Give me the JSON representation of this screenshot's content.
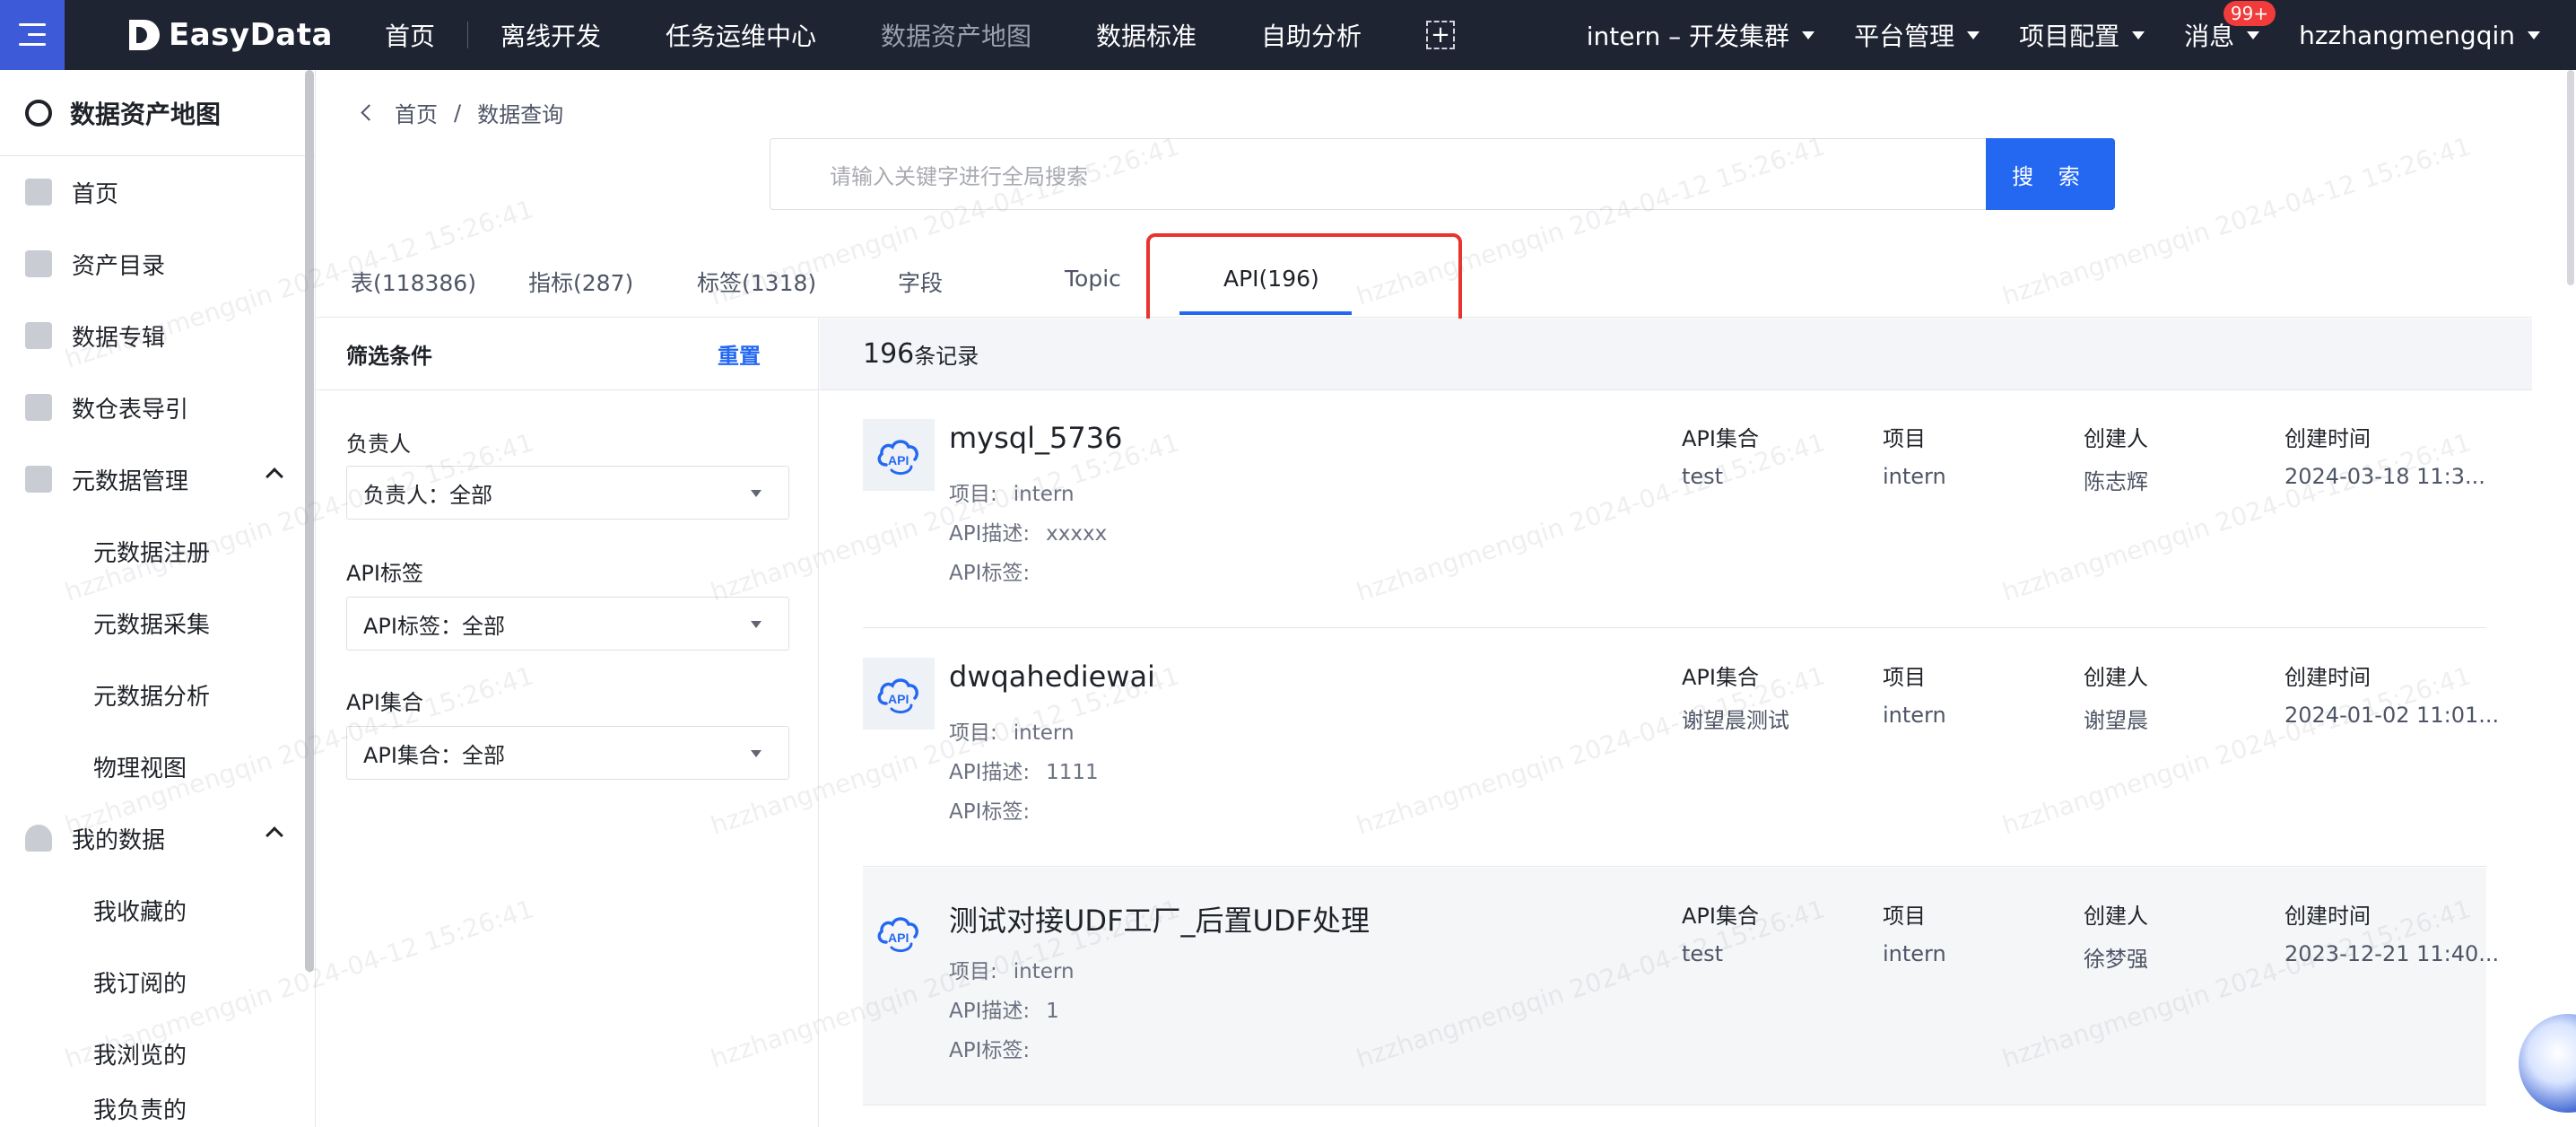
{
  "topnav": {
    "logo_text": "EasyData",
    "items": [
      "首页",
      "离线开发",
      "任务运维中心",
      "数据资产地图",
      "数据标准",
      "自助分析"
    ],
    "cluster": "intern – 开发集群",
    "platform": "平台管理",
    "project": "项目配置",
    "messages": "消息",
    "badge": "99+",
    "user": "hzzhangmengqin"
  },
  "sidebar": {
    "title": "数据资产地图",
    "items": [
      "首页",
      "资产目录",
      "数据专辑",
      "数仓表导引",
      "元数据管理",
      "元数据注册",
      "元数据采集",
      "元数据分析",
      "物理视图",
      "我的数据",
      "我收藏的",
      "我订阅的",
      "我浏览的",
      "我负责的"
    ]
  },
  "breadcrumb": {
    "home": "首页",
    "sep": "/",
    "current": "数据查询"
  },
  "search": {
    "placeholder": "请输入关键字进行全局搜索",
    "button": "搜 索"
  },
  "tabs": [
    "表(118386)",
    "指标(287)",
    "标签(1318)",
    "字段",
    "Topic",
    "API(196)"
  ],
  "filter": {
    "title": "筛选条件",
    "reset": "重置",
    "groups": [
      {
        "label": "负责人",
        "value": "负责人：全部"
      },
      {
        "label": "API标签",
        "value": "API标签：全部"
      },
      {
        "label": "API集合",
        "value": "API集合：全部"
      }
    ]
  },
  "results": {
    "count": "196",
    "unit": "条记录",
    "col_headers": [
      "API集合",
      "项目",
      "创建人",
      "创建时间"
    ],
    "meta_labels": [
      "项目:",
      "API描述:",
      "API标签:"
    ],
    "items": [
      {
        "name": "mysql_5736",
        "project": "intern",
        "desc": "xxxxx",
        "tags": "",
        "collection": "test",
        "proj": "intern",
        "creator": "陈志辉",
        "created": "2024-03-18 11:3..."
      },
      {
        "name": "dwqahediewai",
        "project": "intern",
        "desc": "1111",
        "tags": "",
        "collection": "谢望晨测试",
        "proj": "intern",
        "creator": "谢望晨",
        "created": "2024-01-02 11:01..."
      },
      {
        "name": "测试对接UDF工厂_后置UDF处理",
        "project": "intern",
        "desc": "1",
        "tags": "",
        "collection": "test",
        "proj": "intern",
        "creator": "徐梦强",
        "created": "2023-12-21 11:40..."
      }
    ]
  },
  "watermark": "hzzhangmengqin 2024-04-12 15:26:41",
  "colors": {
    "nav_bg": "#1f2433",
    "accent": "#2468f2",
    "highlight": "#e8342c"
  }
}
